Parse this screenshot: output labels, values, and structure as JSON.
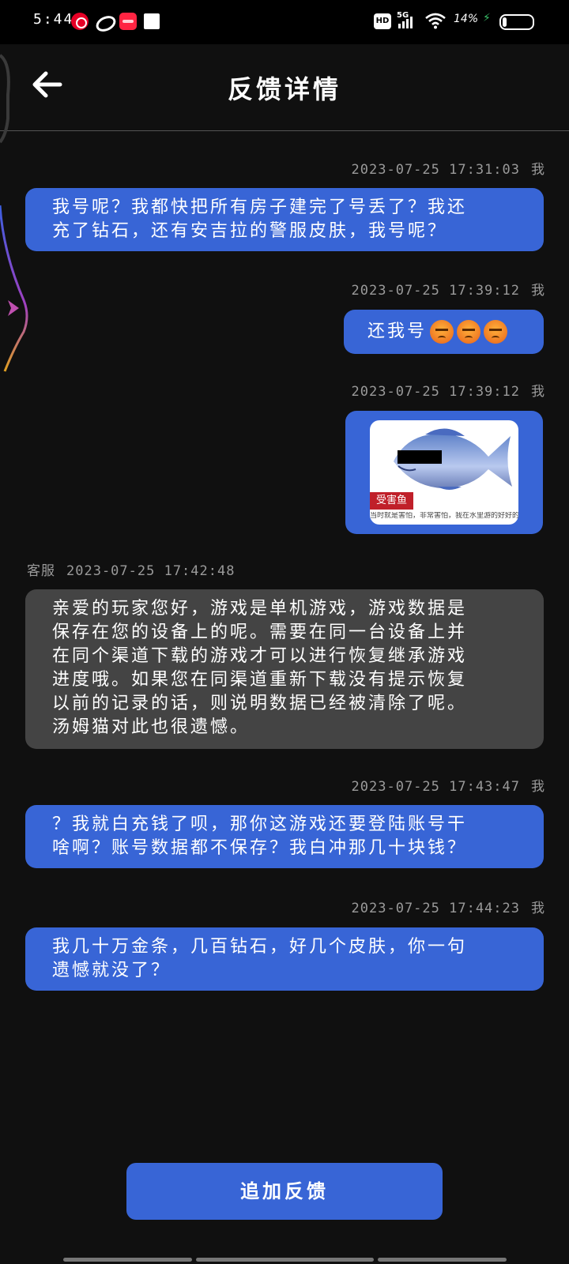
{
  "status_bar": {
    "time": "5:44",
    "hd_badge": "HD",
    "network": "5G",
    "battery_percent": "14%",
    "battery_level": 0.14,
    "apps": [
      "netease-music-icon",
      "oval-app-icon",
      "xiaohongshu-icon",
      "white-square-icon"
    ]
  },
  "header": {
    "title": "反馈详情",
    "back_icon": "arrow-left-icon"
  },
  "messages": [
    {
      "sender": "我",
      "timestamp": "2023-07-25 17:31:03",
      "type": "text",
      "lines": [
        "我号呢？我都快把所有房子建完了号丢了？我还",
        "充了钻石，还有安吉拉的警服皮肤，我号呢？"
      ]
    },
    {
      "sender": "我",
      "timestamp": "2023-07-25 17:39:12",
      "type": "text",
      "text": "还我号",
      "emoji": [
        "angry-face",
        "angry-face",
        "angry-face"
      ]
    },
    {
      "sender": "我",
      "timestamp": "2023-07-25 17:39:12",
      "type": "image",
      "image": {
        "subject": "fish-sticker",
        "tag": "受害鱼",
        "caption": "当时就是害怕，非常害怕，我在水里游的好好的"
      }
    },
    {
      "sender": "客服",
      "timestamp": "2023-07-25 17:42:48",
      "type": "text",
      "lines": [
        "亲爱的玩家您好，游戏是单机游戏，游戏数据是",
        "保存在您的设备上的呢。需要在同一台设备上并",
        "在同个渠道下载的游戏才可以进行恢复继承游戏",
        "进度哦。如果您在同渠道重新下载没有提示恢复",
        "以前的记录的话，则说明数据已经被清除了呢。",
        "汤姆猫对此也很遗憾。"
      ]
    },
    {
      "sender": "我",
      "timestamp": "2023-07-25 17:43:47",
      "type": "text",
      "lines": [
        "？我就白充钱了呗，那你这游戏还要登陆账号干",
        "啥啊？账号数据都不保存？我白冲那几十块钱？"
      ]
    },
    {
      "sender": "我",
      "timestamp": "2023-07-25 17:44:23",
      "type": "text",
      "lines": [
        "我几十万金条，几百钻石，好几个皮肤，你一句",
        "遗憾就没了？"
      ]
    }
  ],
  "footer": {
    "add_feedback_label": "追加反馈"
  },
  "colors": {
    "background": "#101010",
    "my_bubble": "#3865d6",
    "support_bubble": "#444444",
    "timestamp": "#9a9a9a"
  }
}
